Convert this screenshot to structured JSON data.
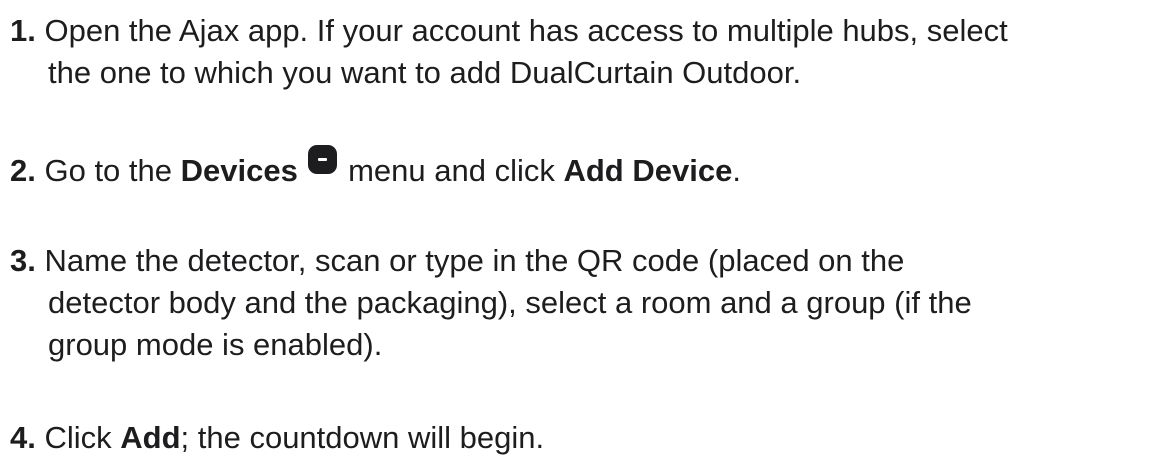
{
  "steps": [
    {
      "number": "1.",
      "lines": [
        " Open the Ajax app. If your account has access to multiple hubs, select",
        "the one to which you want to add DualCurtain Outdoor."
      ]
    },
    {
      "number": "2.",
      "text_a": " Go to the ",
      "bold_a": "Devices",
      "icon": "devices-icon",
      "text_b": " menu and click ",
      "bold_b": "Add Device",
      "text_c": "."
    },
    {
      "number": "3.",
      "lines": [
        " Name the detector, scan or type in the QR code (placed on the",
        "detector body and the packaging), select a room and a group (if the",
        "group mode is enabled)."
      ]
    },
    {
      "number": "4.",
      "text_a": " Click ",
      "bold_a": "Add",
      "text_b": "; the countdown will begin."
    }
  ]
}
